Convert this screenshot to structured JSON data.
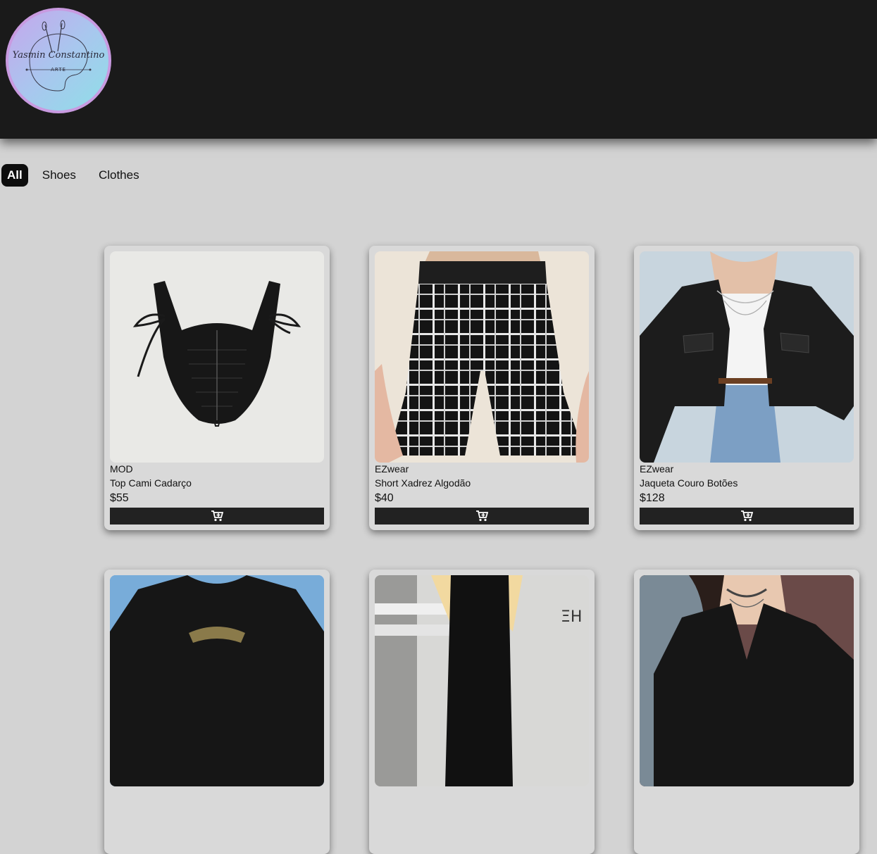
{
  "logo": {
    "name": "Yasmin Constantino",
    "subtitle": "ARTE",
    "icon": "palette-brushes-icon"
  },
  "filters": [
    {
      "label": "All",
      "active": true
    },
    {
      "label": "Shoes",
      "active": false
    },
    {
      "label": "Clothes",
      "active": false
    }
  ],
  "products": [
    {
      "brand": "MOD",
      "name": "Top Cami Cadarço",
      "price": "$55",
      "image": "black lace corset top"
    },
    {
      "brand": "EZwear",
      "name": "Short Xadrez Algodão",
      "price": "$40",
      "image": "black and white plaid shorts"
    },
    {
      "brand": "EZwear",
      "name": "Jaqueta Couro Botões",
      "price": "$128",
      "image": "black leather cropped jacket"
    },
    {
      "image": "black graphic t-shirt"
    },
    {
      "image": "black pants"
    },
    {
      "image": "black leather jacket with chokers"
    }
  ],
  "cart_icon": "add-to-cart-icon",
  "colors": {
    "header_bg": "#1a1a1a",
    "page_bg": "#d3d3d3",
    "button_bg": "#222222",
    "active_filter_bg": "#0d0d0d"
  }
}
